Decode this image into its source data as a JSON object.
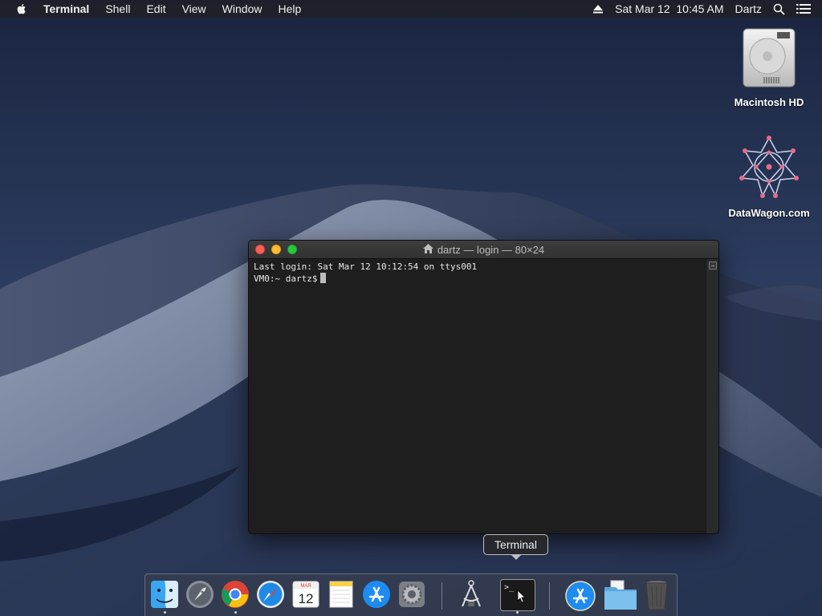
{
  "menubar": {
    "app_name": "Terminal",
    "menus": [
      "Shell",
      "Edit",
      "View",
      "Window",
      "Help"
    ],
    "datetime": "Sat Mar 12  10:45 AM",
    "user": "Dartz"
  },
  "desktop": {
    "icons": [
      {
        "label": "Macintosh HD",
        "icon": "hard-drive-icon"
      },
      {
        "label": "DataWagon.com",
        "icon": "datawagon-icon"
      }
    ]
  },
  "terminal": {
    "title": "dartz — login — 80×24",
    "lines": [
      "Last login: Sat Mar 12 10:12:54 on ttys001",
      "VM0:~ dartz$"
    ]
  },
  "tooltip": {
    "text": "Terminal"
  },
  "dock": {
    "calendar_month": "MAR",
    "calendar_day": "12",
    "apps": [
      {
        "name": "Finder",
        "icon": "finder-icon",
        "running": true
      },
      {
        "name": "Launchpad",
        "icon": "launchpad-icon",
        "running": false
      },
      {
        "name": "Google Chrome",
        "icon": "chrome-icon",
        "running": true
      },
      {
        "name": "Safari",
        "icon": "safari-icon",
        "running": false
      },
      {
        "name": "Calendar",
        "icon": "calendar-icon",
        "running": false
      },
      {
        "name": "Notes",
        "icon": "notes-icon",
        "running": false
      },
      {
        "name": "App Store",
        "icon": "app-store-icon",
        "running": false
      },
      {
        "name": "System Preferences",
        "icon": "system-preferences-icon",
        "running": false
      },
      {
        "name": "Directory Utility",
        "icon": "compass-icon",
        "running": false
      },
      {
        "name": "Terminal",
        "icon": "terminal-icon",
        "running": true
      },
      {
        "name": "App Store Downloads",
        "icon": "app-store-icon",
        "running": false
      },
      {
        "name": "Documents",
        "icon": "folder-icon",
        "running": false
      },
      {
        "name": "Trash",
        "icon": "trash-icon",
        "running": false
      }
    ]
  },
  "colors": {
    "terminal_bg": "#1e1e1e",
    "close": "#fe5f57",
    "minimize": "#febc2e",
    "maximize": "#28c840"
  }
}
